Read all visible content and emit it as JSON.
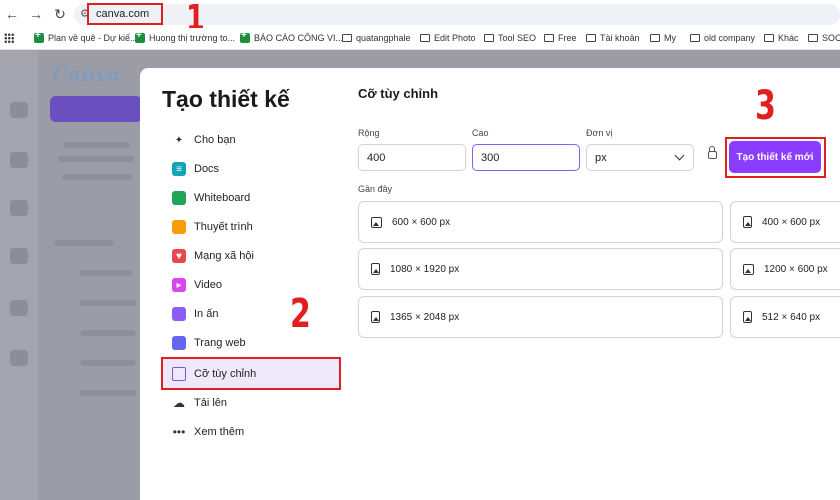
{
  "browser": {
    "url": "canva.com",
    "bookmarks": [
      {
        "label": "Plan về quê - Dự kiế...",
        "icon": "sheets-icon"
      },
      {
        "label": "Huong  thị trường to...",
        "icon": "sheets-icon"
      },
      {
        "label": "BÁO CÁO CÔNG VI...",
        "icon": "sheets-icon"
      },
      {
        "label": "quatangphale",
        "icon": "folder-icon"
      },
      {
        "label": "Edit Photo",
        "icon": "folder-icon"
      },
      {
        "label": "Tool SEO",
        "icon": "folder-icon"
      },
      {
        "label": "Free",
        "icon": "folder-icon"
      },
      {
        "label": "Tài khoản",
        "icon": "folder-icon"
      },
      {
        "label": "My",
        "icon": "folder-icon"
      },
      {
        "label": "old company",
        "icon": "folder-icon"
      },
      {
        "label": "Khác",
        "icon": "folder-icon"
      },
      {
        "label": "SOC",
        "icon": "folder-icon"
      }
    ]
  },
  "annotations": {
    "step1": "1",
    "step2": "2",
    "step3": "3",
    "accent": "#e02020"
  },
  "modal": {
    "title": "Tạo thiết kế",
    "menu": [
      {
        "label": "Cho bạn",
        "icon": "sparkle-icon",
        "color": "#333333"
      },
      {
        "label": "Docs",
        "icon": "docs-icon",
        "color": "#13a3b5"
      },
      {
        "label": "Whiteboard",
        "icon": "whiteboard-icon",
        "color": "#21a35a"
      },
      {
        "label": "Thuyết trình",
        "icon": "presentation-icon",
        "color": "#f59e0b"
      },
      {
        "label": "Mạng xã hội",
        "icon": "heart-icon",
        "color": "#e5484d"
      },
      {
        "label": "Video",
        "icon": "video-icon",
        "color": "#d946ef"
      },
      {
        "label": "In ấn",
        "icon": "print-icon",
        "color": "#8b5cf6"
      },
      {
        "label": "Trang web",
        "icon": "website-icon",
        "color": "#6366f1"
      },
      {
        "label": "Cỡ tùy chỉnh",
        "icon": "custom-size-icon",
        "color": "#6b5bd6",
        "active": true
      },
      {
        "label": "Tải lên",
        "icon": "upload-icon",
        "color": "#333333"
      },
      {
        "label": "Xem thêm",
        "icon": "more-icon",
        "color": "#333333"
      }
    ],
    "custom": {
      "title": "Cỡ tùy chỉnh",
      "width_label": "Rộng",
      "width_value": "400",
      "height_label": "Cao",
      "height_value": "300",
      "unit_label": "Đơn vị",
      "unit_value": "px",
      "create_button": "Tạo thiết kế mới",
      "create_color": "#8b3dff"
    },
    "recent_label": "Gần đây",
    "recent": [
      {
        "label": "600 × 600 px",
        "icon": "image-icon"
      },
      {
        "label": "400 × 600 px",
        "icon": "portrait-image-icon"
      },
      {
        "label": "1080 × 1920 px",
        "icon": "portrait-image-icon"
      },
      {
        "label": "1200 × 600 px",
        "icon": "image-icon"
      },
      {
        "label": "1365 × 2048 px",
        "icon": "portrait-image-icon"
      },
      {
        "label": "512 × 640 px",
        "icon": "portrait-image-icon"
      }
    ]
  }
}
